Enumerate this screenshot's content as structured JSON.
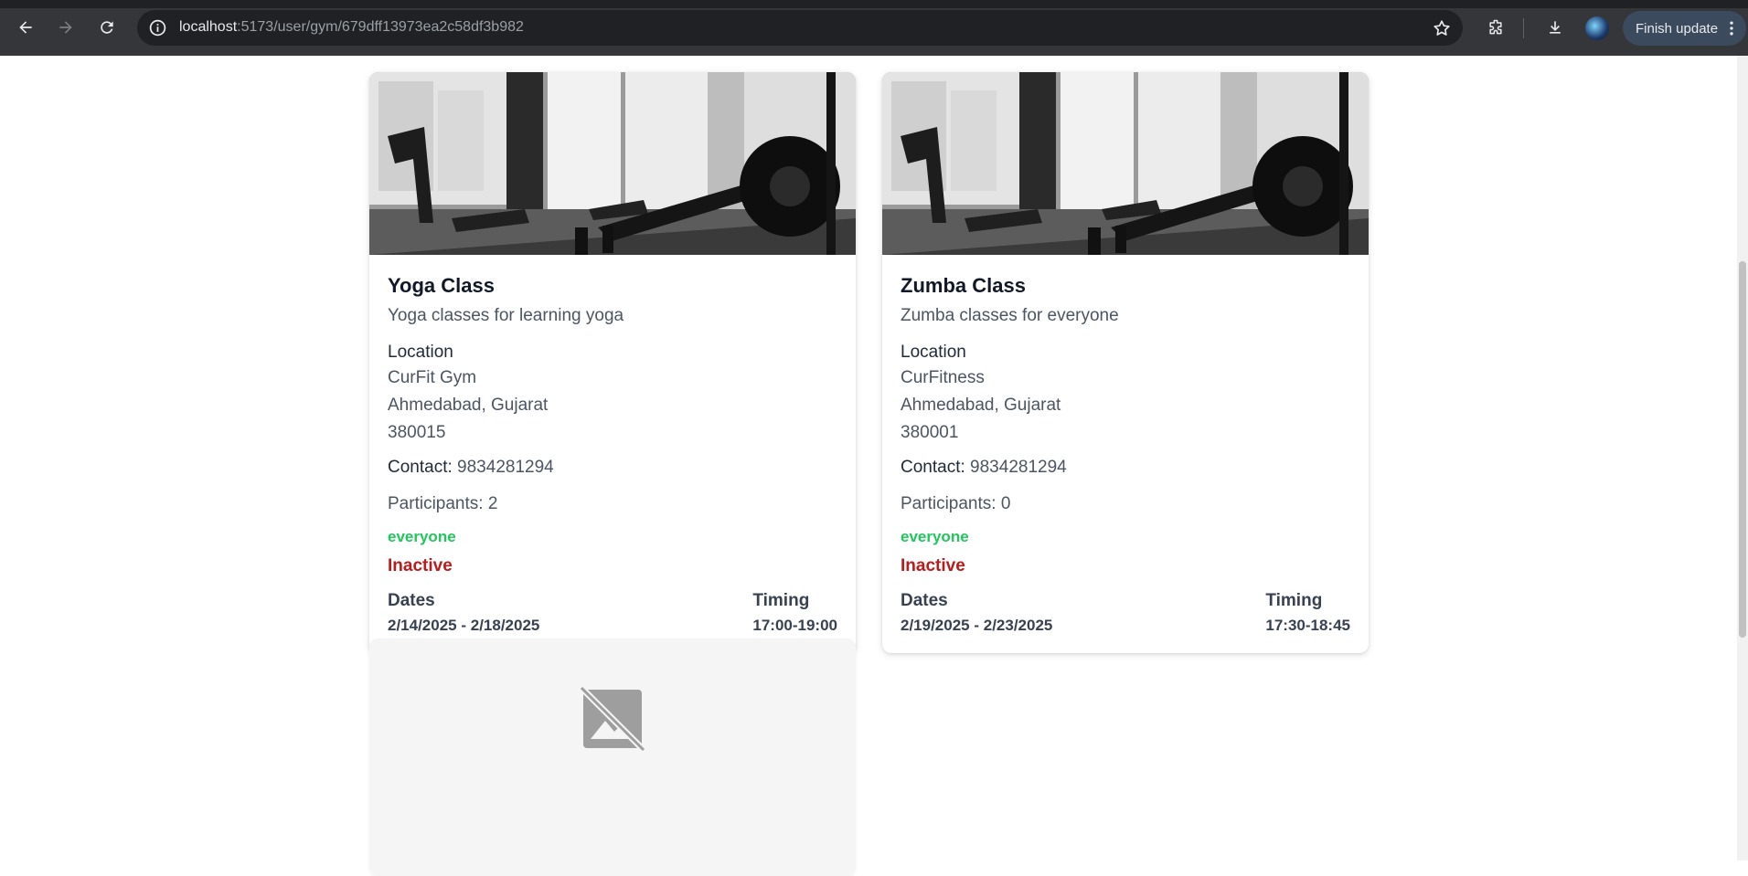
{
  "browser": {
    "url_host": "localhost",
    "url_rest": ":5173/user/gym/679dff13973ea2c58df3b982",
    "update_button": "Finish update"
  },
  "classes": [
    {
      "title": "Yoga Class",
      "description": "Yoga classes for learning yoga",
      "location_label": "Location",
      "gym_name": "CurFit Gym",
      "city_state": "Ahmedabad, Gujarat",
      "pincode": "380015",
      "contact_label": "Contact:",
      "contact": "9834281294",
      "participants": "Participants: 2",
      "audience": "everyone",
      "status": "Inactive",
      "dates_label": "Dates",
      "dates": "2/14/2025 - 2/18/2025",
      "timing_label": "Timing",
      "timing": "17:00-19:00"
    },
    {
      "title": "Zumba Class",
      "description": "Zumba classes for everyone",
      "location_label": "Location",
      "gym_name": "CurFitness",
      "city_state": "Ahmedabad, Gujarat",
      "pincode": "380001",
      "contact_label": "Contact:",
      "contact": "9834281294",
      "participants": "Participants: 0",
      "audience": "everyone",
      "status": "Inactive",
      "dates_label": "Dates",
      "dates": "2/19/2025 - 2/23/2025",
      "timing_label": "Timing",
      "timing": "17:30-18:45"
    }
  ],
  "colors": {
    "audience": "#22c55e",
    "inactive": "#b91c1c",
    "chrome_bg": "#35363a"
  },
  "icons": [
    "back-icon",
    "forward-icon",
    "reload-icon",
    "site-info-icon",
    "star-icon",
    "extensions-icon",
    "download-icon",
    "more-icon",
    "image-off-icon"
  ]
}
